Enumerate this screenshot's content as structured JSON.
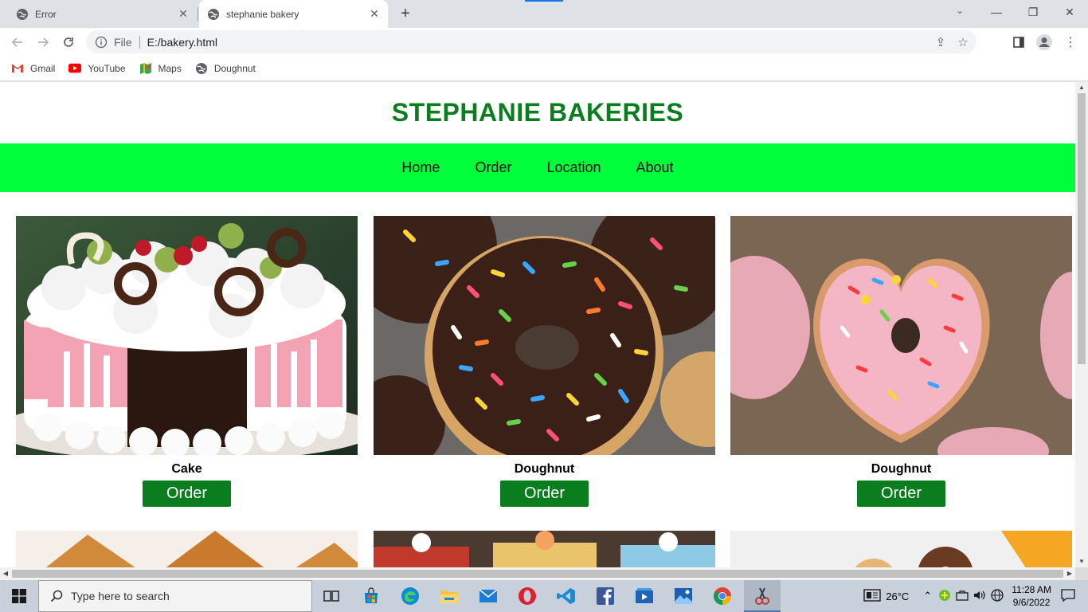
{
  "browser": {
    "tabs": [
      {
        "title": "Error"
      },
      {
        "title": "stephanie bakery"
      }
    ],
    "address": {
      "scheme": "File",
      "url": "E:/bakery.html"
    },
    "bookmarks": [
      {
        "label": "Gmail",
        "icon": "gmail-icon"
      },
      {
        "label": "YouTube",
        "icon": "youtube-icon"
      },
      {
        "label": "Maps",
        "icon": "maps-icon"
      },
      {
        "label": "Doughnut",
        "icon": "globe-icon"
      }
    ]
  },
  "site": {
    "title": "STEPHANIE BAKERIES",
    "nav": [
      "Home",
      "Order",
      "Location",
      "About"
    ],
    "products": [
      {
        "name": "Cake",
        "button": "Order"
      },
      {
        "name": "Doughnut",
        "button": "Order"
      },
      {
        "name": "Doughnut",
        "button": "Order"
      }
    ]
  },
  "taskbar": {
    "search_placeholder": "Type here to search",
    "temperature": "26°C",
    "time": "11:28 AM",
    "date": "9/6/2022"
  },
  "colors": {
    "brand_green": "#0a7d1e",
    "nav_green": "#00ff3a"
  }
}
